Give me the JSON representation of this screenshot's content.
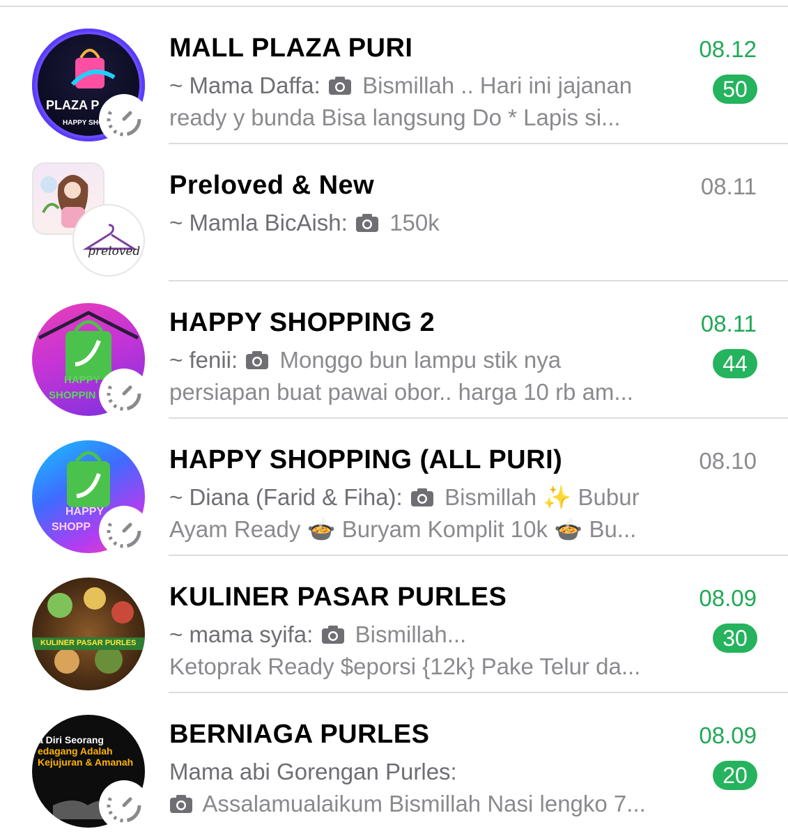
{
  "chats": [
    {
      "title": "MALL PLAZA PURI",
      "time": "08.12",
      "unread": "50",
      "sender": "~ Mama Daffa:",
      "line1": "Bismillah ..  Hari ini jajanan",
      "line2": "ready y bunda  Bisa langsung Do    * Lapis si...",
      "avatar_text": "PLAZA P",
      "avatar_sub": "HAPPY SHO"
    },
    {
      "title": "Preloved & New",
      "time": "08.11",
      "sender": "~ Mamla BicAish:",
      "line1": "150k",
      "avatar_text": "preloved"
    },
    {
      "title": "HAPPY SHOPPING 2",
      "time": "08.11",
      "unread": "44",
      "sender": "~ fenii:",
      "line1": "Monggo bun lampu stik nya",
      "line2": "persiapan buat pawai obor..  harga 10 rb am...",
      "avatar_text": "HAPPY",
      "avatar_sub": "SHOPPIN"
    },
    {
      "title": "HAPPY SHOPPING (ALL PURI)",
      "time": "08.10",
      "sender": "~ Diana (Farid & Fiha):",
      "line1": "Bismillah ✨  Bubur",
      "line2": "Ayam  Ready  🍲 Buryam Komplit 10k  🍲 Bu...",
      "avatar_text": "HAPPY",
      "avatar_sub": "SHOPP"
    },
    {
      "title": "KULINER PASAR PURLES",
      "time": "08.09",
      "unread": "30",
      "sender": "~ mama syifa:",
      "line1": "Bismillah...",
      "line2": "Ketoprak Ready $eporsi {12k}  Pake Telur da...",
      "avatar_text": "KULINER PASAR PURLES"
    },
    {
      "title": "BERNIAGA PURLES",
      "time": "08.09",
      "unread": "20",
      "sender": "Mama abi Gorengan Purles:",
      "line2": "Assalamualaikum Bismillah Nasi lengko 7...",
      "avatar_text": "a Diri Seorang",
      "avatar_sub": "edagang Adalah",
      "avatar_sub2": "Kejujuran & Amanah"
    }
  ],
  "colors": {
    "unread_green": "#1fa855",
    "badge_green": "#25b35d",
    "muted_text": "#8a8a8e"
  },
  "icons": [
    "camera-icon",
    "status-ring-icon"
  ]
}
